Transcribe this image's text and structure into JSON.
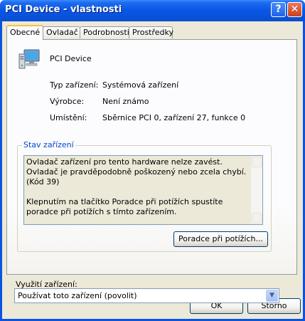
{
  "window": {
    "title": "PCI Device - vlastnosti",
    "help_glyph": "?",
    "close_glyph": "✕"
  },
  "tabs": [
    {
      "label": "Obecné",
      "active": true
    },
    {
      "label": "Ovladač",
      "active": false
    },
    {
      "label": "Podrobnosti",
      "active": false
    },
    {
      "label": "Prostředky",
      "active": false
    }
  ],
  "device": {
    "icon": "computer-device-icon",
    "name": "PCI Device"
  },
  "properties": [
    {
      "label": "Typ zařízení:",
      "value": "Systémová zařízení"
    },
    {
      "label": "Výrobce:",
      "value": "Není známo"
    },
    {
      "label": "Umístění:",
      "value": "Sběrnice PCI 0, zařízení 27, funkce 0"
    }
  ],
  "status": {
    "group_title": "Stav zařízení",
    "paragraph1": "Ovladač zařízení pro tento hardware nelze zavést. Ovladač je pravděpodobně poškozený nebo zcela chybí. (Kód 39)",
    "paragraph2": "Klepnutím na tlačítko Poradce při potížích spustíte poradce při potížích s tímto zařízením.",
    "troubleshoot_label": "Poradce při potížích..."
  },
  "usage": {
    "label": "Využití zařízení:",
    "selected": "Používat toto zařízení (povolit)"
  },
  "buttons": {
    "ok": "OK",
    "cancel": "Storno"
  },
  "colors": {
    "titlebar": "#0a58e6",
    "face": "#ece9d8",
    "group_title": "#0046d5"
  }
}
